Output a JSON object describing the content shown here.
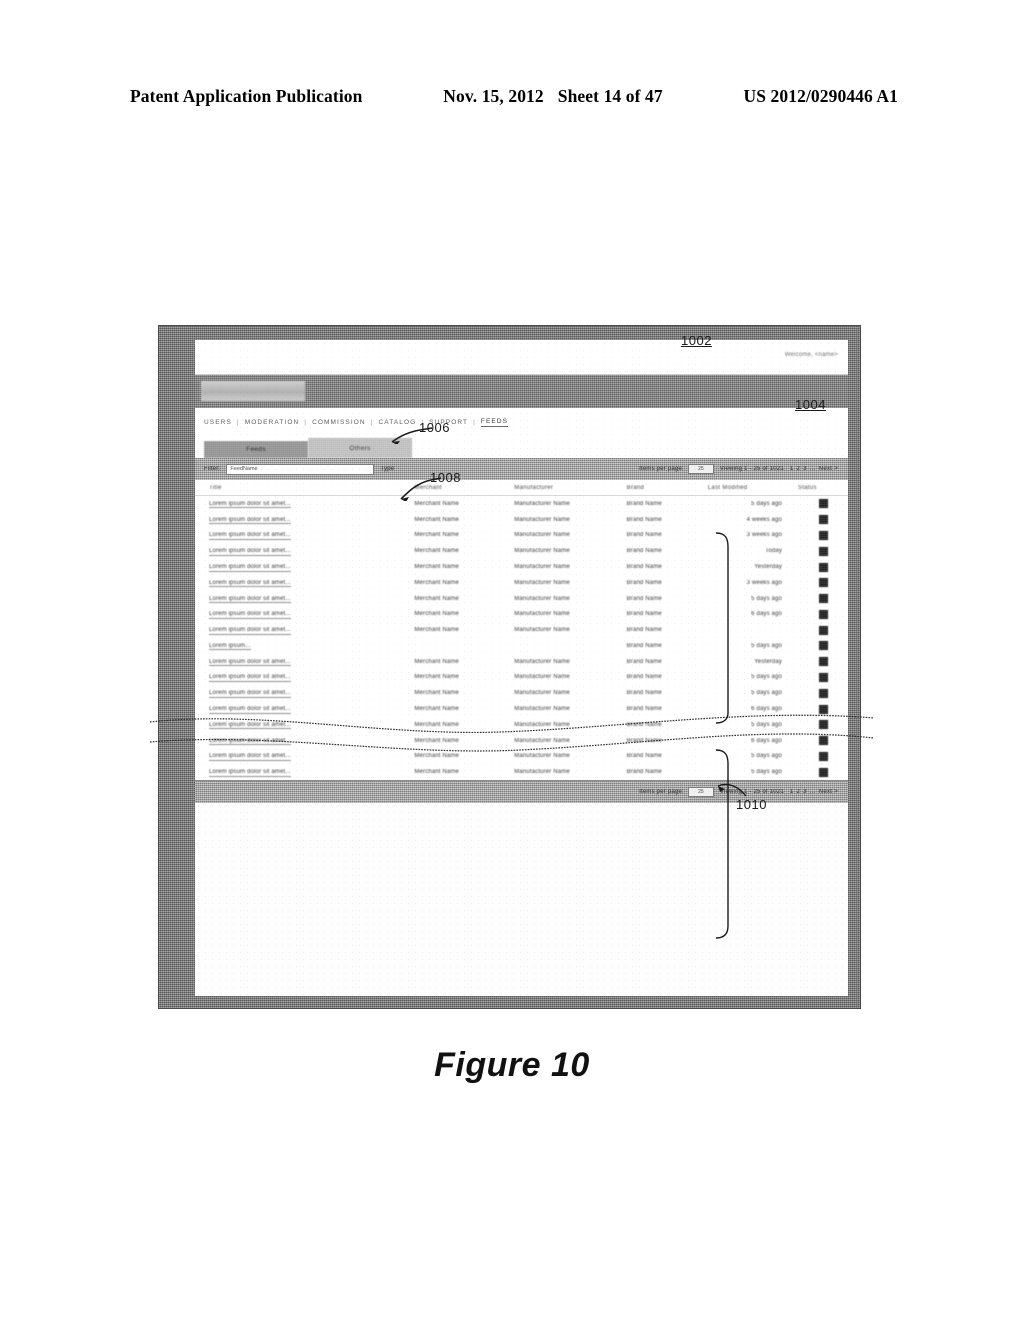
{
  "patent_header": {
    "left": "Patent Application Publication",
    "date": "Nov. 15, 2012",
    "sheet": "Sheet 14 of 47",
    "number": "US 2012/0290446 A1"
  },
  "figure": {
    "caption": "Figure 10"
  },
  "callouts": [
    {
      "id": "1002",
      "label": "1002"
    },
    {
      "id": "1004",
      "label": "1004"
    },
    {
      "id": "1006",
      "label": "1006"
    },
    {
      "id": "1008",
      "label": "1008"
    },
    {
      "id": "1010",
      "label": "1010"
    }
  ],
  "screen": {
    "topbar": {
      "welcome_text": "Welcome, <name>"
    },
    "banner": {
      "logo_alt": "site-logo"
    },
    "nav": {
      "items": [
        {
          "label": "USERS",
          "active": false
        },
        {
          "label": "MODERATION",
          "active": false
        },
        {
          "label": "COMMISSION",
          "active": false
        },
        {
          "label": "CATALOG",
          "active": false
        },
        {
          "label": "SUPPORT",
          "active": false
        },
        {
          "label": "FEEDS",
          "active": true
        }
      ],
      "separator": "|"
    },
    "tabs": [
      {
        "label": "Feeds",
        "active": true
      },
      {
        "label": "Others",
        "active": false
      }
    ],
    "toolbar_top": {
      "filter_label": "Filter:",
      "filter_value": "FeedName",
      "filter_type_label": "Type",
      "items_per_page_label": "Items per page:",
      "items_per_page_value": "25",
      "viewing_label": "Viewing 1 - 25 of 1021",
      "pager": [
        "1",
        "2",
        "3",
        "...",
        "Next >"
      ]
    },
    "toolbar_bottom": {
      "items_per_page_label": "Items per page:",
      "items_per_page_value": "25",
      "viewing_label": "Viewing 1 - 25 of 1021",
      "pager": [
        "1",
        "2",
        "3",
        "...",
        "Next >"
      ]
    },
    "table": {
      "columns": [
        "Title",
        "Merchant",
        "Manufacturer",
        "Brand",
        "Last Modified",
        "Status"
      ],
      "rows_top": [
        {
          "title": "Lorem ipsum dolor sit amet...",
          "merchant": "Merchant Name",
          "manufacturer": "Manufacturer Name",
          "brand": "Brand Name",
          "modified": "5 days ago",
          "status": "status-icon"
        },
        {
          "title": "Lorem ipsum dolor sit amet...",
          "merchant": "Merchant Name",
          "manufacturer": "Manufacturer Name",
          "brand": "Brand Name",
          "modified": "4 weeks ago",
          "status": "status-icon"
        },
        {
          "title": "Lorem ipsum dolor sit amet...",
          "merchant": "Merchant Name",
          "manufacturer": "Manufacturer Name",
          "brand": "Brand Name",
          "modified": "3 weeks ago",
          "status": "status-icon"
        },
        {
          "title": "Lorem ipsum dolor sit amet...",
          "merchant": "Merchant Name",
          "manufacturer": "Manufacturer Name",
          "brand": "Brand Name",
          "modified": "Today",
          "status": "status-icon"
        },
        {
          "title": "Lorem ipsum dolor sit amet...",
          "merchant": "Merchant Name",
          "manufacturer": "Manufacturer Name",
          "brand": "Brand Name",
          "modified": "Yesterday",
          "status": "status-icon"
        },
        {
          "title": "Lorem ipsum dolor sit amet...",
          "merchant": "Merchant Name",
          "manufacturer": "Manufacturer Name",
          "brand": "Brand Name",
          "modified": "3 weeks ago",
          "status": "status-icon"
        },
        {
          "title": "Lorem ipsum dolor sit amet...",
          "merchant": "Merchant Name",
          "manufacturer": "Manufacturer Name",
          "brand": "Brand Name",
          "modified": "5 days ago",
          "status": "status-icon"
        },
        {
          "title": "Lorem ipsum dolor sit amet...",
          "merchant": "Merchant Name",
          "manufacturer": "Manufacturer Name",
          "brand": "Brand Name",
          "modified": "6 days ago",
          "status": "status-icon"
        },
        {
          "title": "Lorem ipsum dolor sit amet...",
          "merchant": "Merchant Name",
          "manufacturer": "Manufacturer Name",
          "brand": "Brand Name",
          "modified": "",
          "status": "status-icon"
        }
      ],
      "rows_bottom": [
        {
          "title": "Lorem ipsum...",
          "merchant": "",
          "manufacturer": "",
          "brand": "Brand Name",
          "modified": "5 days ago",
          "status": "status-icon"
        },
        {
          "title": "Lorem ipsum dolor sit amet...",
          "merchant": "Merchant Name",
          "manufacturer": "Manufacturer Name",
          "brand": "Brand Name",
          "modified": "Yesterday",
          "status": "status-icon"
        },
        {
          "title": "Lorem ipsum dolor sit amet...",
          "merchant": "Merchant Name",
          "manufacturer": "Manufacturer Name",
          "brand": "Brand Name",
          "modified": "5 days ago",
          "status": "status-icon"
        },
        {
          "title": "Lorem ipsum dolor sit amet...",
          "merchant": "Merchant Name",
          "manufacturer": "Manufacturer Name",
          "brand": "Brand Name",
          "modified": "5 days ago",
          "status": "status-icon"
        },
        {
          "title": "Lorem ipsum dolor sit amet...",
          "merchant": "Merchant Name",
          "manufacturer": "Manufacturer Name",
          "brand": "Brand Name",
          "modified": "6 days ago",
          "status": "status-icon"
        },
        {
          "title": "Lorem ipsum dolor sit amet...",
          "merchant": "Merchant Name",
          "manufacturer": "Manufacturer Name",
          "brand": "Brand Name",
          "modified": "5 days ago",
          "status": "status-icon"
        },
        {
          "title": "Lorem ipsum dolor sit amet...",
          "merchant": "Merchant Name",
          "manufacturer": "Manufacturer Name",
          "brand": "Brand Name",
          "modified": "6 days ago",
          "status": "status-icon"
        },
        {
          "title": "Lorem ipsum dolor sit amet...",
          "merchant": "Merchant Name",
          "manufacturer": "Manufacturer Name",
          "brand": "Brand Name",
          "modified": "5 days ago",
          "status": "status-icon"
        },
        {
          "title": "Lorem ipsum dolor sit amet...",
          "merchant": "Merchant Name",
          "manufacturer": "Manufacturer Name",
          "brand": "Brand Name",
          "modified": "5 days ago",
          "status": "status-icon"
        }
      ]
    }
  },
  "colors": {
    "frame": "#6d6d6d",
    "banner": "#7a7a7a",
    "toolbar": "#9b9b9b",
    "tab_active": "#8e8e8e",
    "tab_idle": "#b9b9b9",
    "page_bg": "#ffffff",
    "text": "#3c3c3c"
  }
}
